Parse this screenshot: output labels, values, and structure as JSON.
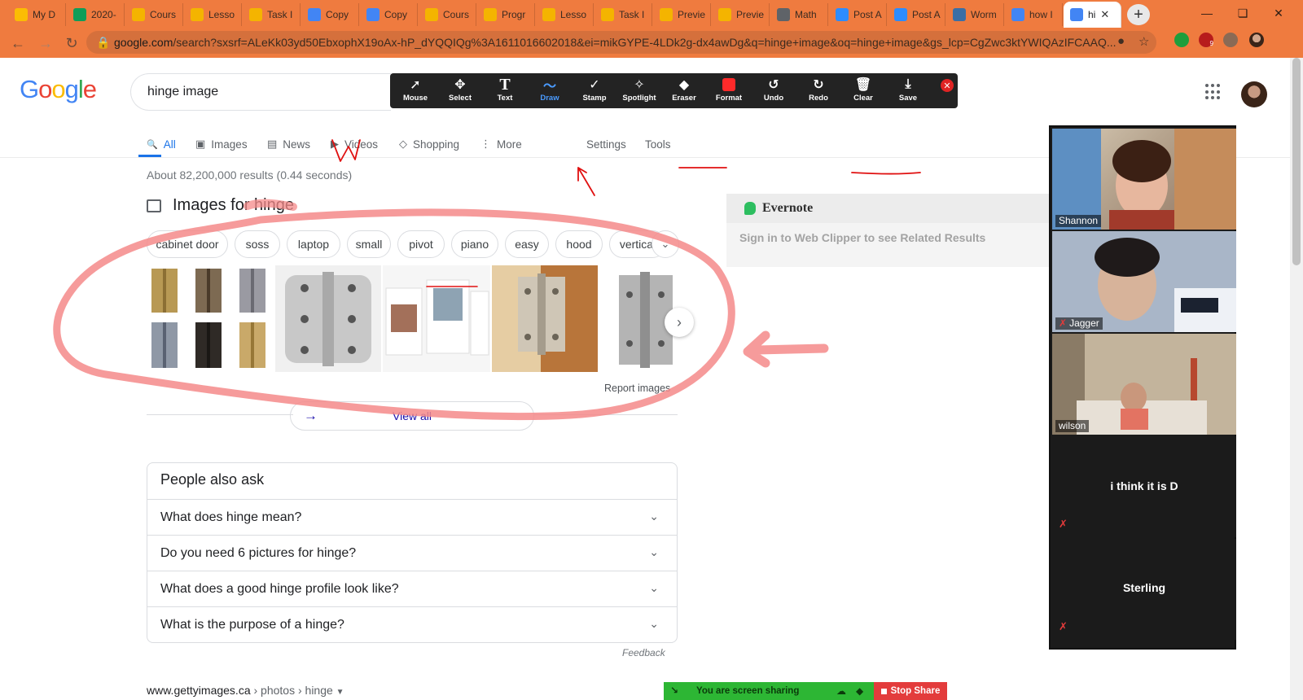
{
  "browser": {
    "tabs": [
      {
        "label": "My D",
        "color": "#fbbc04"
      },
      {
        "label": "2020-",
        "color": "#0f9d58"
      },
      {
        "label": "Cours",
        "color": "#f4b400"
      },
      {
        "label": "Lesso",
        "color": "#f4b400"
      },
      {
        "label": "Task I",
        "color": "#f4b400"
      },
      {
        "label": "Copy",
        "color": "#4285f4"
      },
      {
        "label": "Copy",
        "color": "#4285f4"
      },
      {
        "label": "Cours",
        "color": "#f4b400"
      },
      {
        "label": "Progr",
        "color": "#f4b400"
      },
      {
        "label": "Lesso",
        "color": "#f4b400"
      },
      {
        "label": "Task I",
        "color": "#f4b400"
      },
      {
        "label": "Previe",
        "color": "#f4b400"
      },
      {
        "label": "Previe",
        "color": "#f4b400"
      },
      {
        "label": "Math",
        "color": "#5f6368"
      },
      {
        "label": "Post A",
        "color": "#2d8cff"
      },
      {
        "label": "Post A",
        "color": "#2d8cff"
      },
      {
        "label": "Worm",
        "color": "#3a6ea5"
      },
      {
        "label": "how I",
        "color": "#4285f4"
      },
      {
        "label": "hi",
        "color": "#4285f4",
        "active": true
      }
    ],
    "new_tab": "+",
    "url_host": "google.com",
    "url_rest": "/search?sxsrf=ALeKk03yd50EbxophX19oAx-hP_dYQQIQg%3A1611016602018&ei=mikGYPE-4LDk2g-dx4awDg&q=hinge+image&oq=hinge+image&gs_lcp=CgZwc3ktYWIQAzIFCAAQ...",
    "ext_badge": "9"
  },
  "google": {
    "logo": [
      "G",
      "o",
      "o",
      "g",
      "l",
      "e"
    ],
    "logo_colors": [
      "#4285f4",
      "#ea4335",
      "#fbbc05",
      "#4285f4",
      "#34a853",
      "#ea4335"
    ],
    "query": "hinge image",
    "tabs": [
      {
        "label": "All",
        "icon": "search-icon",
        "active": true
      },
      {
        "label": "Images",
        "icon": "image-icon"
      },
      {
        "label": "News",
        "icon": "news-icon"
      },
      {
        "label": "Videos",
        "icon": "video-icon"
      },
      {
        "label": "Shopping",
        "icon": "tag-icon"
      },
      {
        "label": "More",
        "icon": "more-vert-icon"
      }
    ],
    "settings": "Settings",
    "tools": "Tools",
    "result_stats": "About 82,200,000 results (0.44 seconds)",
    "images_heading_prefix": "Images for",
    "images_heading_term": "hinge",
    "chips": [
      "cabinet door",
      "soss",
      "laptop",
      "small",
      "pivot",
      "piano",
      "easy",
      "hood",
      "vertical"
    ],
    "report_images": "Report images",
    "view_all": "View all",
    "paa_title": "People also ask",
    "paa_questions": [
      "What does hinge mean?",
      "Do you need 6 pictures for hinge?",
      "What does a good hinge profile look like?",
      "What is the purpose of a hinge?"
    ],
    "feedback": "Feedback",
    "cite_host": "www.gettyimages.ca",
    "cite_path": " › photos › hinge"
  },
  "zoom_toolbar": {
    "tools": [
      {
        "label": "Mouse",
        "icon": "cursor-icon"
      },
      {
        "label": "Select",
        "icon": "move-icon"
      },
      {
        "label": "Text",
        "icon": "text-icon"
      },
      {
        "label": "Draw",
        "icon": "draw-icon",
        "active": true
      },
      {
        "label": "Stamp",
        "icon": "check-icon"
      },
      {
        "label": "Spotlight",
        "icon": "wand-icon"
      },
      {
        "label": "Eraser",
        "icon": "eraser-icon"
      },
      {
        "label": "Format",
        "icon": "color-swatch-icon"
      },
      {
        "label": "Undo",
        "icon": "undo-icon"
      },
      {
        "label": "Redo",
        "icon": "redo-icon"
      },
      {
        "label": "Clear",
        "icon": "trash-icon"
      },
      {
        "label": "Save",
        "icon": "save-icon"
      }
    ],
    "format_color": "#ff2a2a"
  },
  "evernote": {
    "title": "Evernote",
    "message": "Sign in to Web Clipper to see Related Results"
  },
  "participants": [
    {
      "name": "Shannon",
      "video": true,
      "muted": false
    },
    {
      "name": "Jagger",
      "video": true,
      "muted": true
    },
    {
      "name": "wilson",
      "video": true,
      "muted": false,
      "speaking": true
    },
    {
      "name": "i think it is D",
      "video": false,
      "muted": true
    },
    {
      "name": "Sterling",
      "video": false,
      "muted": true
    }
  ],
  "screen_share": {
    "status": "You are screen sharing",
    "stop": "Stop Share"
  },
  "colors": {
    "chrome_frame": "#ef7b3f",
    "annotation_pink": "#f58a8a",
    "annotation_red": "#e01010",
    "link_blue": "#1a0dab",
    "accent_blue": "#1a73e8"
  }
}
